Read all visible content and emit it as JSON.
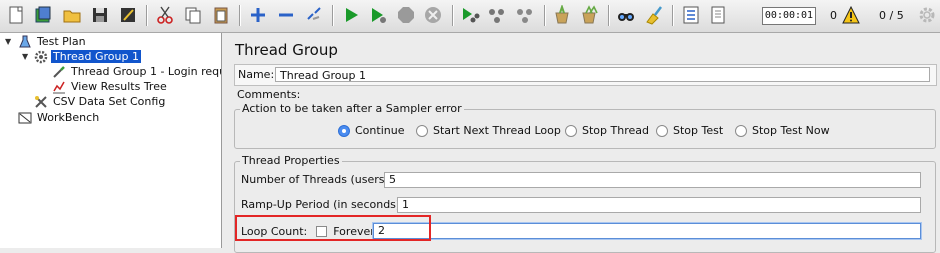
{
  "toolbar": {
    "timer": "00:00:01",
    "error_count": "0",
    "thread_count": "0 / 5"
  },
  "tree": {
    "root": "Test Plan",
    "thread_group": "Thread Group 1",
    "sampler": "Thread Group 1 - Login reque",
    "listener": "View Results Tree",
    "csv_config": "CSV Data Set Config",
    "workbench": "WorkBench"
  },
  "panel": {
    "title": "Thread Group",
    "name_label": "Name:",
    "name_value": "Thread Group 1",
    "comments_label": "Comments:"
  },
  "error_action": {
    "legend": "Action to be taken after a Sampler error",
    "options": [
      "Continue",
      "Start Next Thread Loop",
      "Stop Thread",
      "Stop Test",
      "Stop Test Now"
    ],
    "selected": "Continue"
  },
  "thread_properties": {
    "legend": "Thread Properties",
    "threads_label": "Number of Threads (users):",
    "threads_value": "5",
    "rampup_label": "Ramp-Up Period (in seconds):",
    "rampup_value": "1",
    "loop_label": "Loop Count:",
    "forever_label": "Forever",
    "forever_checked": false,
    "loop_value": "2"
  },
  "colors": {
    "selection": "#1155cc",
    "highlight_box": "#e32626",
    "run_green": "#1a9a2a"
  }
}
